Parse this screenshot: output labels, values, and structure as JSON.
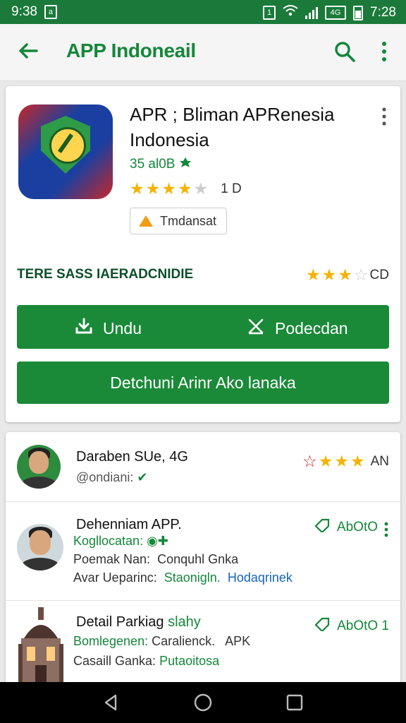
{
  "status_bar": {
    "time_left": "9:38",
    "time_right": "7:28",
    "battery_level": 0.7
  },
  "app_bar": {
    "title": "APP Indoneail"
  },
  "app": {
    "name": "APR ; Bliman APRenesia Indonesia",
    "meta": "35 al0B",
    "rating": 4,
    "rating_count": "1 D",
    "chip_label": "Tmdansat",
    "info_label": "TERE SASS IAERADCNIDIE",
    "info_rating": 3,
    "info_rating_label": "CD",
    "primary_left_label": "Undu",
    "primary_right_label": "Podecdan",
    "secondary_label": "Detchuni Arinr Ako lanaka"
  },
  "list": [
    {
      "name": "Daraben SUe, 4G",
      "sub": "@ondiani:",
      "rating_label": "AN",
      "stars": 4
    },
    {
      "name": "Dehenniam APP.",
      "line2": "Kogllocatan:",
      "line3_a": "Poemak Nan:",
      "line3_b": "Conquhl Gnka",
      "line4_a": "Avar Ueparinc:",
      "line4_b": "Staonigln.",
      "line4_c": "Hodaqrinek",
      "version": "AbOtO"
    },
    {
      "name": "Detail Parkiag",
      "name_accent": "slahy",
      "line2_a": "Bomlegenen:",
      "line2_b": "Caralienck.",
      "line2_c": "APK",
      "line3_a": "Casaill Ganka:",
      "line3_b": "Putaoitosa",
      "version": "AbOtO 1"
    }
  ],
  "colors": {
    "status_bar": "#1b7a3a",
    "primary": "#1a8a38",
    "accent_text": "#14873a",
    "star": "#f5b301"
  }
}
